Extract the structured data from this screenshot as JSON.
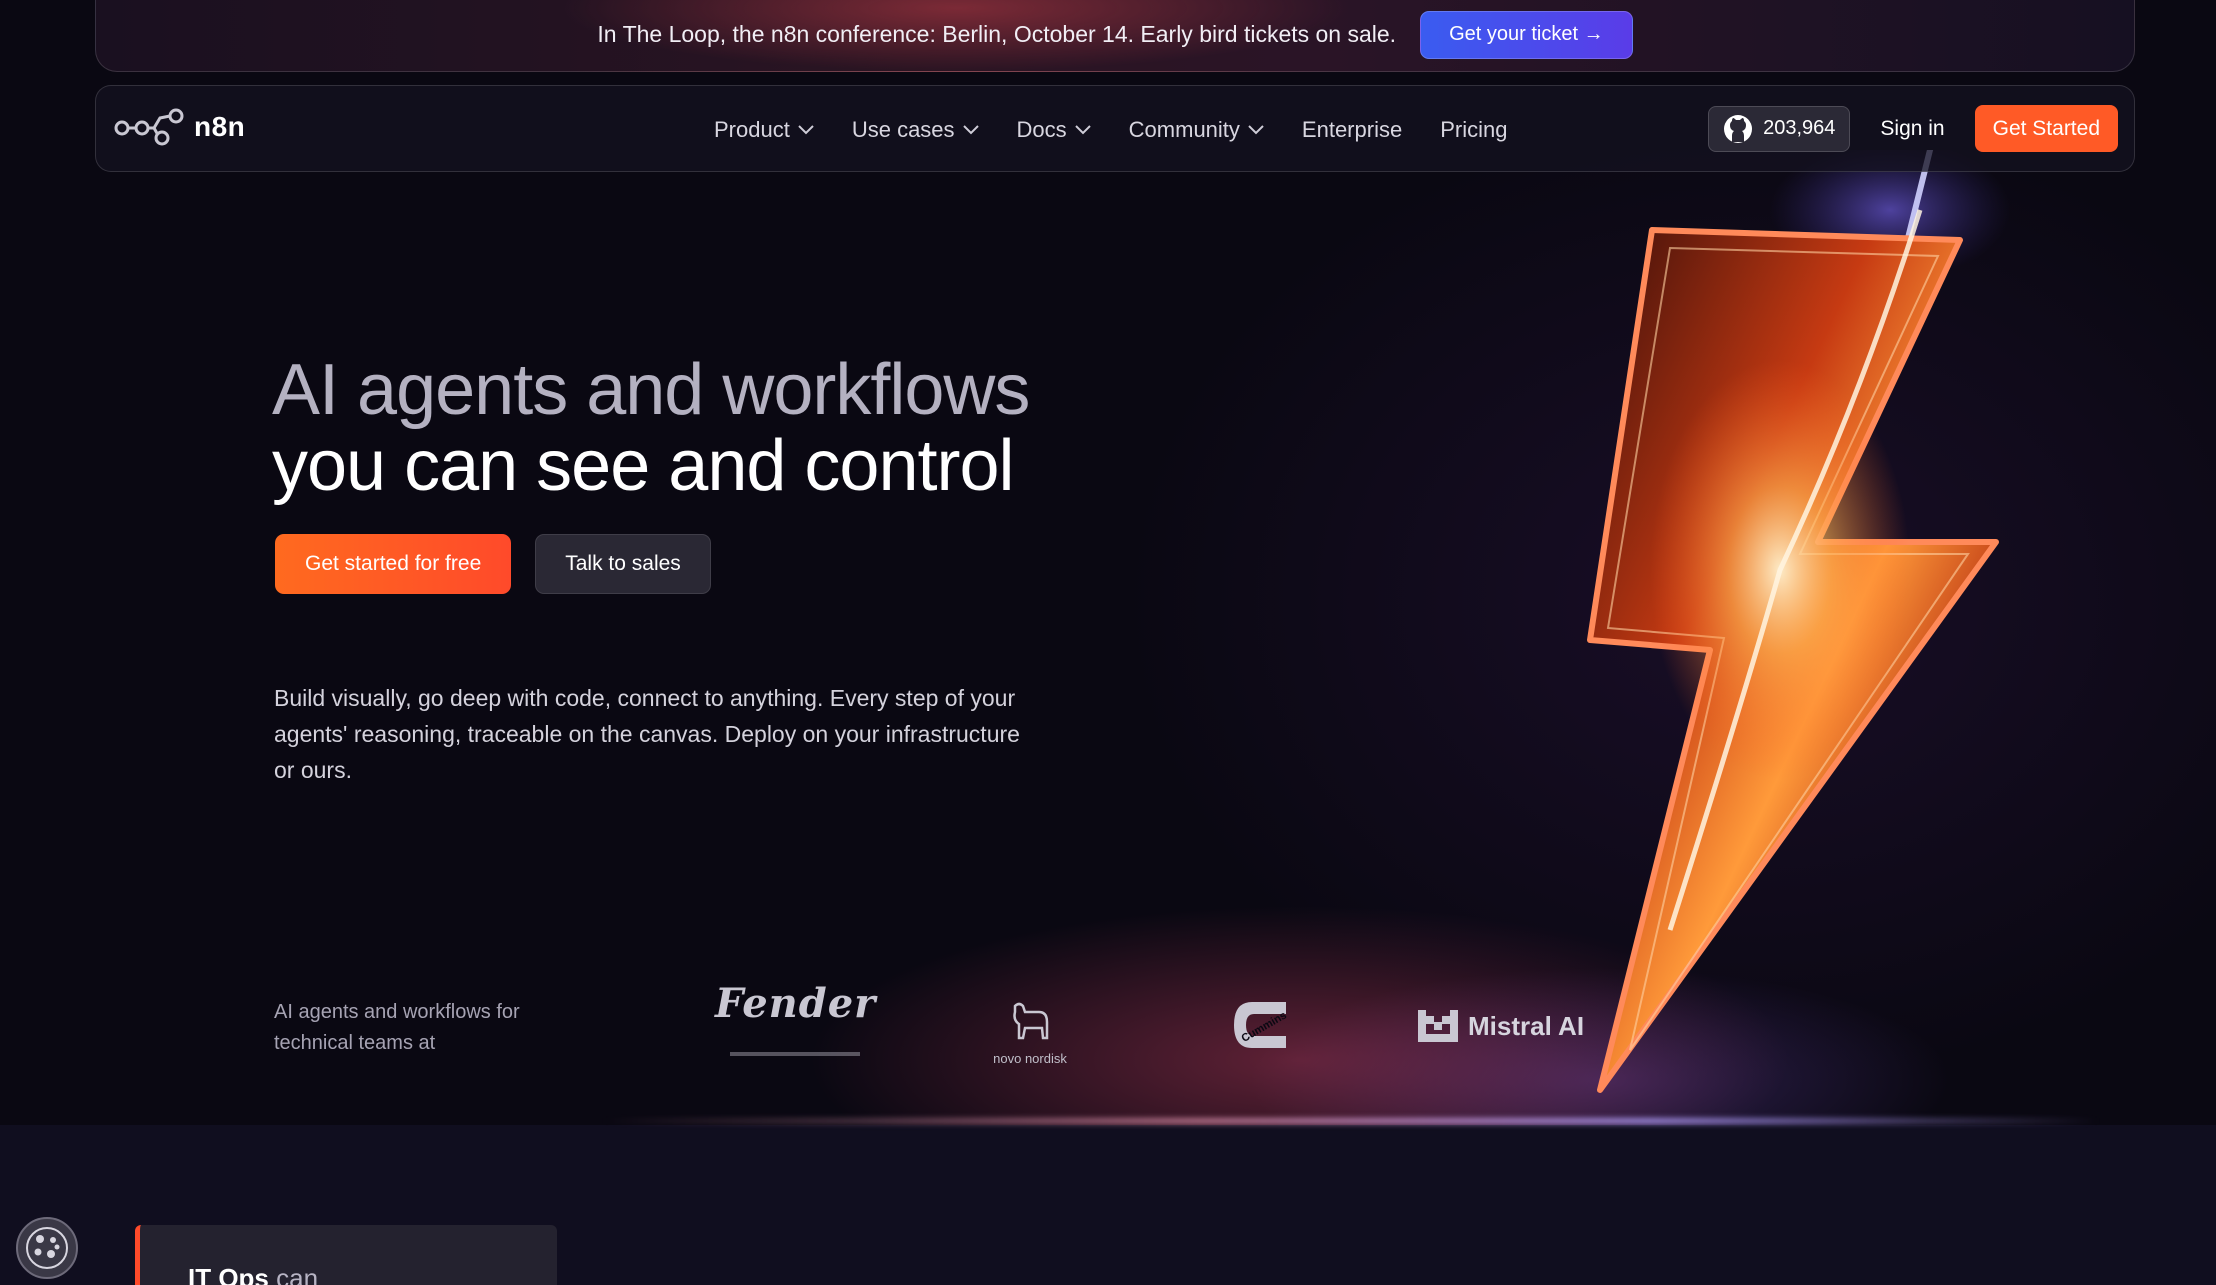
{
  "banner": {
    "text": "In The Loop, the n8n conference: Berlin, October 14. Early bird tickets on sale.",
    "button_label": "Get your ticket →"
  },
  "nav": {
    "logo_text": "n8n",
    "items": [
      {
        "label": "Product",
        "has_dropdown": true
      },
      {
        "label": "Use cases",
        "has_dropdown": true
      },
      {
        "label": "Docs",
        "has_dropdown": true
      },
      {
        "label": "Community",
        "has_dropdown": true
      },
      {
        "label": "Enterprise",
        "has_dropdown": false
      },
      {
        "label": "Pricing",
        "has_dropdown": false
      }
    ],
    "github_stars": "203,964",
    "signin_label": "Sign in",
    "get_started_label": "Get Started"
  },
  "hero": {
    "title_line1": "AI agents and workflows",
    "title_line2": "you can see and control",
    "cta_primary": "Get started for free",
    "cta_secondary": "Talk to sales",
    "description": "Build visually, go deep with code, connect to anything. Every step of your agents' reasoning, traceable on the canvas. Deploy on your infrastructure or ours."
  },
  "logos": {
    "caption": "AI agents and workflows for technical teams at",
    "brands": [
      "Fender",
      "novo nordisk",
      "Cummins",
      "Mistral AI"
    ]
  },
  "card": {
    "title": "IT Ops",
    "suffix": " can"
  },
  "colors": {
    "accent": "#ff5a26",
    "banner_button": "#4a4cec",
    "background": "#0a0812"
  }
}
